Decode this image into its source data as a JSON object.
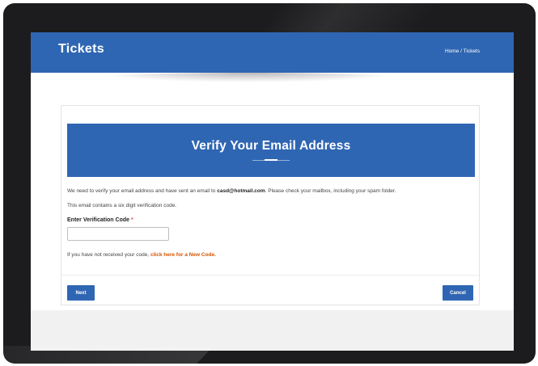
{
  "header": {
    "title": "Tickets",
    "breadcrumb_home": "Home",
    "breadcrumb_sep": " / ",
    "breadcrumb_current": "Tickets"
  },
  "card": {
    "title": "Verify Your Email Address",
    "message_prefix": "We need to verify your email address and have sent an email to ",
    "email": "casd@hotmail.com",
    "message_suffix": ". Please check your mailbox, including your spam folder.",
    "info": "This email contains a six digit verification code.",
    "field_label": "Enter Verification Code",
    "required_marker": "*",
    "code_value": "",
    "resend_prefix": "If you have not received your code, ",
    "resend_link": "click here for a New Code.",
    "next_label": "Next",
    "cancel_label": "Cancel"
  },
  "colors": {
    "primary": "#2f66b3",
    "link": "#d35400",
    "required": "#d9534f"
  }
}
